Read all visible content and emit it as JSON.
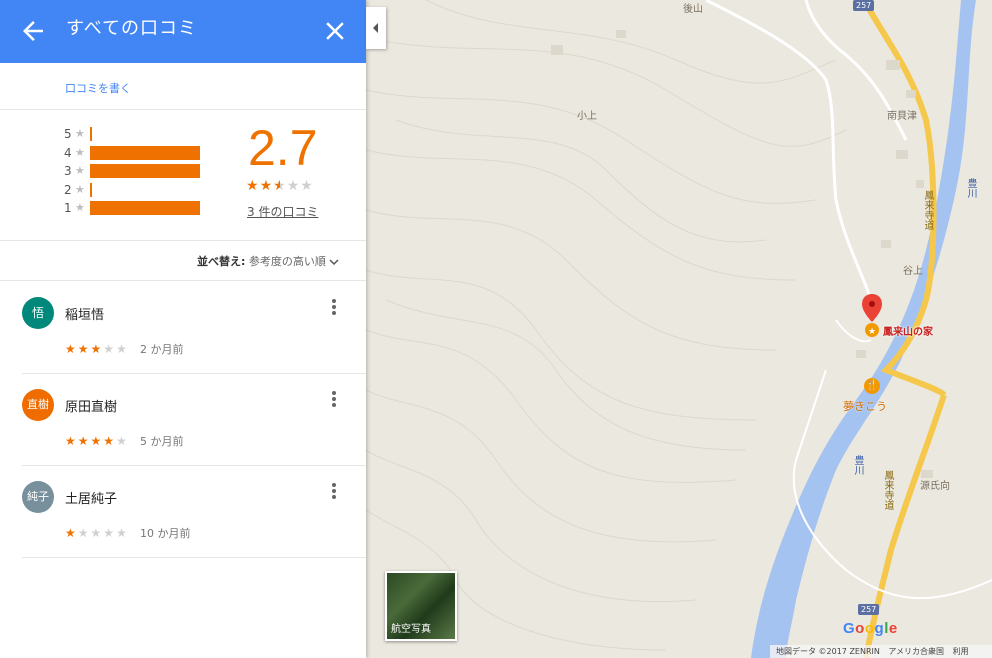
{
  "panel": {
    "title": "すべての口コミ",
    "write_review": "口コミを書く",
    "histogram": [
      {
        "stars": "5",
        "fraction": 0.0
      },
      {
        "stars": "4",
        "fraction": 1.0
      },
      {
        "stars": "3",
        "fraction": 1.0
      },
      {
        "stars": "2",
        "fraction": 0.0
      },
      {
        "stars": "1",
        "fraction": 1.0
      }
    ],
    "rating": "2.7",
    "rating_value": 2.7,
    "review_count": "3 件の口コミ",
    "sort_label": "並べ替え:",
    "sort_value": "参考度の高い順",
    "reviews": [
      {
        "initial": "悟",
        "name": "稲垣悟",
        "stars": 3,
        "time": "2 か月前",
        "avatar_color": "#00897b"
      },
      {
        "initial": "直樹",
        "name": "原田直樹",
        "stars": 4,
        "time": "5 か月前",
        "avatar_color": "#ef6c00"
      },
      {
        "initial": "純子",
        "name": "土居純子",
        "stars": 1,
        "time": "10 か月前",
        "avatar_color": "#78909c"
      }
    ]
  },
  "icons": {
    "back": "arrow-left-icon",
    "close": "close-icon",
    "collapse": "chevron-left-icon",
    "more": "more-vert-icon"
  },
  "map": {
    "place_name": "鳳来山の家",
    "restaurant": "夢きこう",
    "aerial_label": "航空写真",
    "google_logo": "Google",
    "attribution": [
      "地図データ ©2017 ZENRIN",
      "アメリカ合衆国",
      "利用"
    ],
    "route_shields": [
      "257",
      "257"
    ],
    "labels": [
      "後山",
      "小上",
      "南貝津",
      "谷上",
      "源氏向",
      "鳳来寺道",
      "鳳来寺道",
      "豊川",
      "豊川"
    ]
  },
  "colors": {
    "header": "#4285f4",
    "accent": "#ef7200",
    "river": "#a4c3f0",
    "road": "#f5c84c",
    "marker": "#ea4335"
  }
}
